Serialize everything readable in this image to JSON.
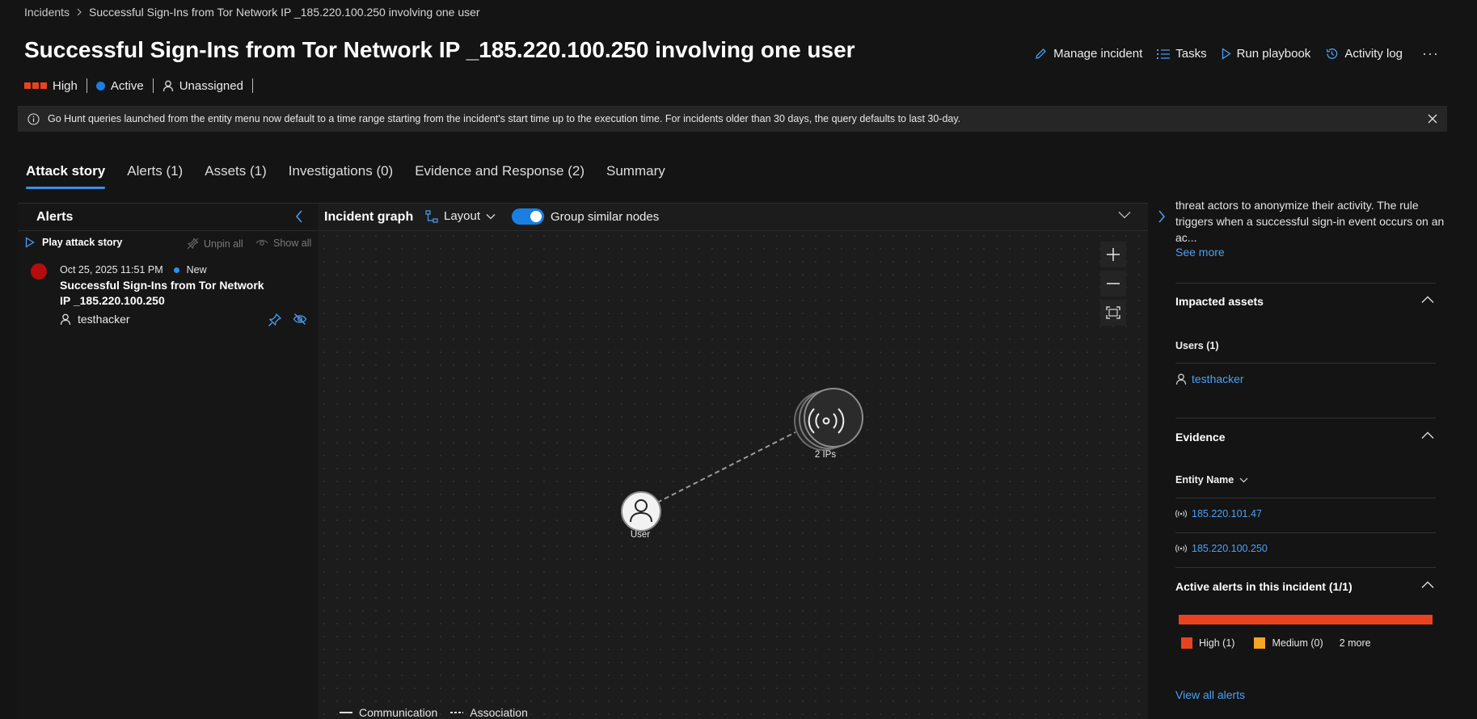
{
  "breadcrumb": {
    "root": "Incidents",
    "current": "Successful Sign-Ins from Tor Network IP _185.220.100.250 involving one user"
  },
  "incident": {
    "title": "Successful Sign-Ins from Tor Network IP _185.220.100.250 involving one user",
    "severity": "High",
    "status": "Active",
    "assignment": "Unassigned"
  },
  "actions": {
    "manage": "Manage incident",
    "tasks": "Tasks",
    "run_playbook": "Run playbook",
    "activity_log": "Activity log",
    "more": "···"
  },
  "info_banner": "Go Hunt queries launched from the entity menu now default to a time range starting from the incident's start time up to the execution time. For incidents older than 30 days, the query defaults to last 30-day.",
  "tabs": [
    {
      "label": "Attack story",
      "active": true
    },
    {
      "label": "Alerts (1)"
    },
    {
      "label": "Assets (1)"
    },
    {
      "label": "Investigations (0)"
    },
    {
      "label": "Evidence and Response (2)"
    },
    {
      "label": "Summary"
    }
  ],
  "alerts_panel": {
    "title": "Alerts",
    "play": "Play attack story",
    "unpin_all": "Unpin all",
    "show_all": "Show all",
    "alert": {
      "date": "Oct 25, 2025 11:51 PM",
      "status": "New",
      "title": "Successful Sign-Ins from Tor Network IP _185.220.100.250",
      "user": "testhacker"
    }
  },
  "graph": {
    "title": "Incident graph",
    "layout": "Layout",
    "group_toggle": "Group similar nodes",
    "group_on": true,
    "nodes": {
      "ip_group": "2 IPs",
      "user": "User"
    },
    "legend": {
      "communication": "Communication",
      "association": "Association"
    }
  },
  "details": {
    "description": "threat actors to anonymize their activity. The rule triggers when a successful sign-in event occurs on an ac...",
    "see_more": "See more",
    "impacted_assets": {
      "title": "Impacted assets",
      "users_head": "Users (1)",
      "user": "testhacker"
    },
    "evidence": {
      "title": "Evidence",
      "entity_name": "Entity Name",
      "ips": [
        "185.220.101.47",
        "185.220.100.250"
      ]
    },
    "active_alerts": {
      "title": "Active alerts in this incident (1/1)",
      "high": "High (1)",
      "medium": "Medium (0)",
      "more": "2 more",
      "high_color": "#e8431f",
      "medium_color": "#f5a623"
    },
    "view_all": "View all alerts"
  },
  "colors": {
    "accent": "#1a7fe0",
    "link": "#4aa0f5",
    "severity_high": "#e8431f",
    "alert_dot": "#b50d0d"
  }
}
